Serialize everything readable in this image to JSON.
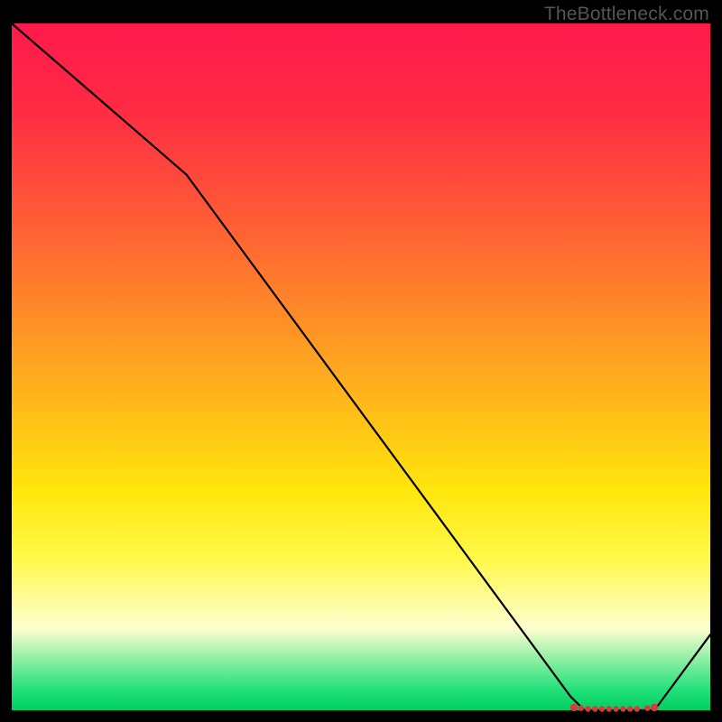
{
  "watermark": "TheBottleneck.com",
  "chart_data": {
    "type": "line",
    "title": "",
    "xlabel": "",
    "ylabel": "",
    "xlim": [
      0,
      100
    ],
    "ylim": [
      0,
      100
    ],
    "grid": false,
    "series": [
      {
        "name": "curve",
        "x": [
          0,
          25,
          80,
          82,
          87,
          92,
          100
        ],
        "values": [
          100,
          78,
          2,
          0,
          0,
          0,
          11
        ]
      }
    ],
    "markers": {
      "x": [
        80.5,
        81.5,
        82.5,
        83.5,
        84.5,
        85.5,
        86.5,
        87.5,
        88.5,
        89.5,
        91.0,
        92.0
      ],
      "y": [
        0.4,
        0.3,
        0.2,
        0.2,
        0.2,
        0.2,
        0.2,
        0.2,
        0.2,
        0.2,
        0.3,
        0.4
      ],
      "color": "#d63a3a"
    }
  }
}
